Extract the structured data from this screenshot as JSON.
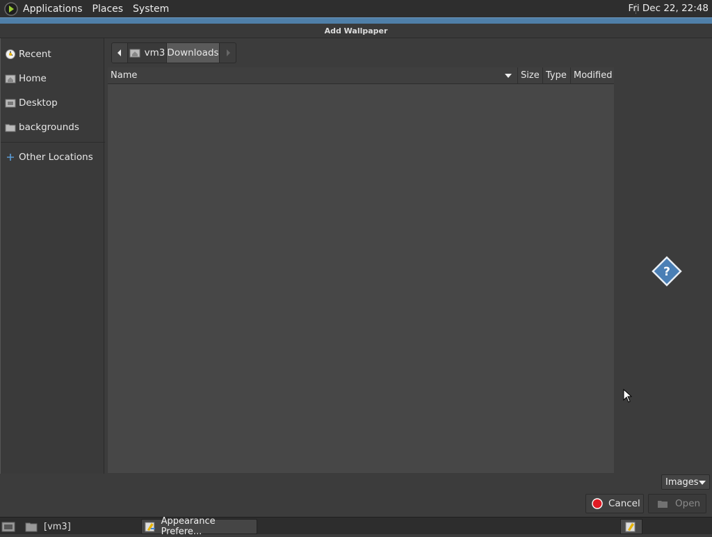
{
  "topbar": {
    "menus": [
      "Applications",
      "Places",
      "System"
    ],
    "clock": "Fri Dec 22, 22:48"
  },
  "window": {
    "title": "Add Wallpaper"
  },
  "sidebar": {
    "items": [
      {
        "label": "Recent",
        "icon": "recent-icon"
      },
      {
        "label": "Home",
        "icon": "home-icon"
      },
      {
        "label": "Desktop",
        "icon": "desktop-folder-icon"
      },
      {
        "label": "backgrounds",
        "icon": "folder-icon"
      }
    ],
    "other": {
      "label": "Other Locations",
      "icon": "plus-icon"
    }
  },
  "pathbar": {
    "segments": [
      "vm3",
      "Downloads"
    ],
    "active": "Downloads"
  },
  "filelist": {
    "columns": [
      "Name",
      "Size",
      "Type",
      "Modified"
    ],
    "rows": []
  },
  "preview": {
    "icon": "question-icon"
  },
  "filter": {
    "selected": "Images"
  },
  "actions": {
    "cancel": "Cancel",
    "open": "Open"
  },
  "taskbar": {
    "items": [
      {
        "label": "[vm3]",
        "icon": "folder-icon"
      },
      {
        "label": "Appearance Prefere...",
        "icon": "appearance-icon"
      }
    ]
  },
  "colors": {
    "accent": "#4f7fa8",
    "cancel_red": "#e01b24",
    "panel": "#2e2e2e",
    "list_bg": "#474747"
  }
}
